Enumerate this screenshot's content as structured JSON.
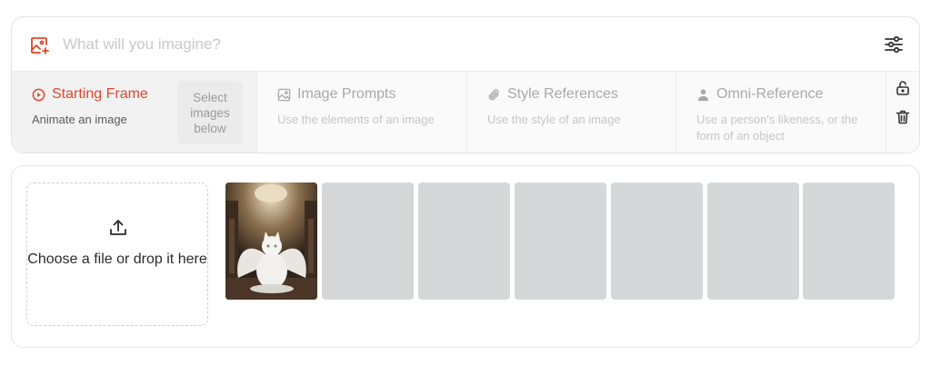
{
  "prompt": {
    "placeholder": "What will you imagine?",
    "value": "",
    "icons": {
      "left": "image-plus-icon",
      "right": "sliders-icon"
    }
  },
  "references": [
    {
      "title": "Starting Frame",
      "subtitle": "Animate an image",
      "icon": "play-circle-icon",
      "active": true
    },
    {
      "title": "Image Prompts",
      "subtitle": "Use the elements of an image",
      "icon": "image-icon",
      "active": false
    },
    {
      "title": "Style References",
      "subtitle": "Use the style of an image",
      "icon": "paperclip-icon",
      "active": false
    },
    {
      "title": "Omni-Reference",
      "subtitle": "Use a person's likeness, or the form of an object",
      "icon": "person-icon",
      "active": false
    }
  ],
  "select_images": {
    "label": "Select images below"
  },
  "side_actions": {
    "icons": [
      "unlock-icon",
      "trash-icon"
    ]
  },
  "upload": {
    "text": "Choose a file or drop it here",
    "icon": "upload-icon"
  },
  "gallery": {
    "items": [
      {
        "kind": "image",
        "description": "white cat with angel wings in ornate hall"
      },
      {
        "kind": "placeholder"
      },
      {
        "kind": "placeholder"
      },
      {
        "kind": "placeholder"
      },
      {
        "kind": "placeholder"
      },
      {
        "kind": "placeholder"
      },
      {
        "kind": "placeholder"
      }
    ]
  },
  "colors": {
    "accent": "#e0462a",
    "placeholder_tile": "#d6d7d9",
    "border": "#e3e3e3"
  }
}
